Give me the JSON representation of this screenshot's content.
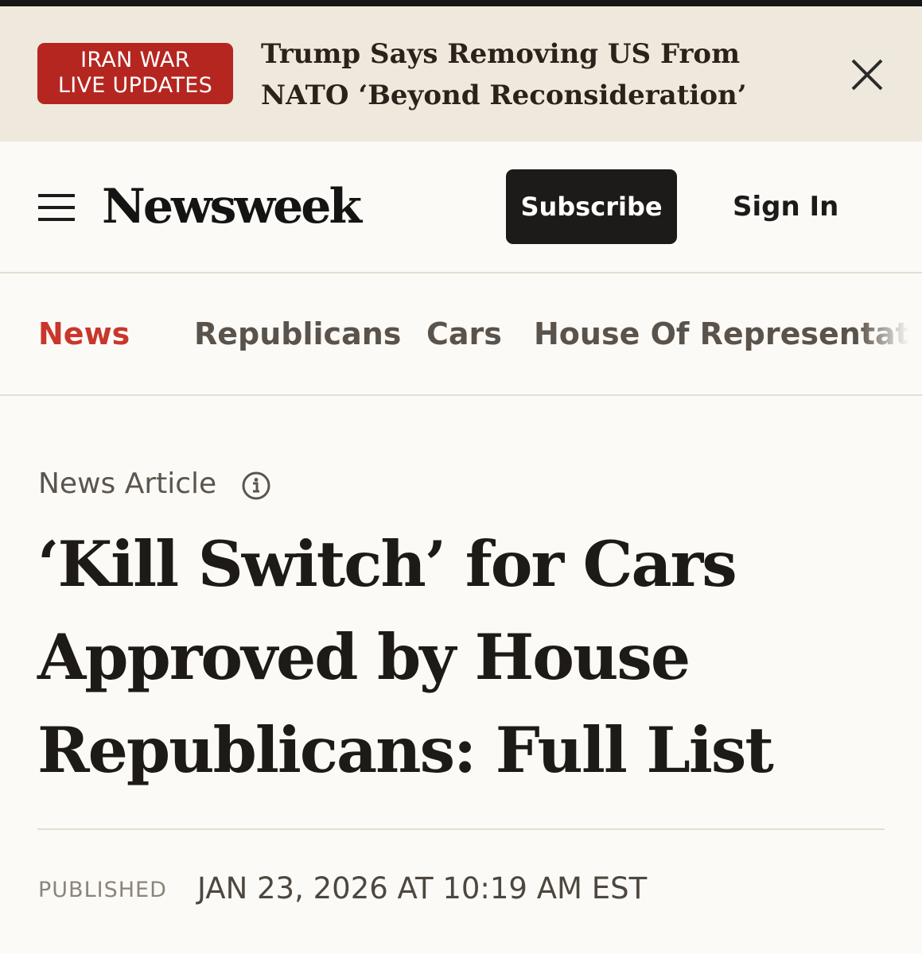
{
  "banner": {
    "badge_line1": "IRAN WAR",
    "badge_line2": "LIVE UPDATES",
    "headline": "Trump Says Removing US From NATO ‘Beyond Reconsideration’",
    "close_icon": "close-icon"
  },
  "header": {
    "menu_icon": "hamburger-menu-icon",
    "logo": "Newsweek",
    "subscribe_label": "Subscribe",
    "signin_label": "Sign In"
  },
  "topics": {
    "items": [
      {
        "label": "News",
        "active": true
      },
      {
        "label": "Republicans",
        "active": false
      },
      {
        "label": "Cars",
        "active": false
      },
      {
        "label": "House Of Representatives",
        "active": false
      }
    ]
  },
  "article": {
    "kicker": "News Article",
    "kicker_icon": "info-icon",
    "headline": "‘Kill Switch’ for Cars Approved by House Republicans: Full List",
    "published_label": "PUBLISHED",
    "published_date": "JAN 23, 2026 AT 10:19 AM EST"
  },
  "colors": {
    "accent_red": "#c8362c",
    "badge_red": "#b4261f",
    "banner_bg": "#efe9dd",
    "page_bg": "#fbfaf6",
    "button_dark": "#1c1b19"
  }
}
